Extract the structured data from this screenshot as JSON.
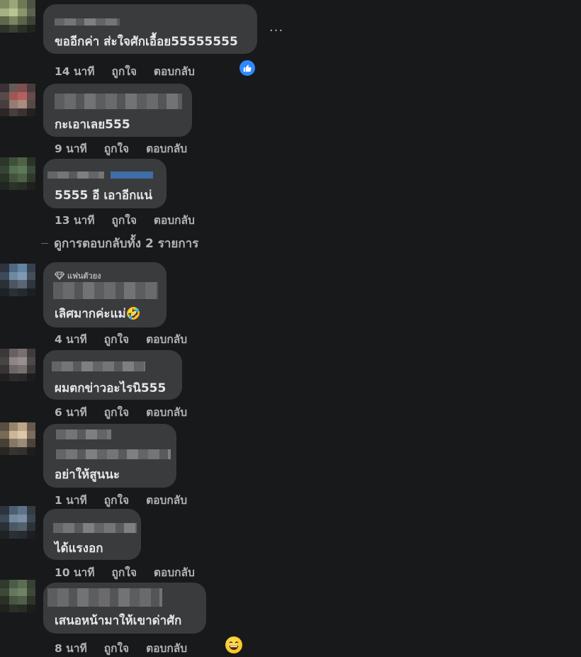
{
  "comments": [
    {
      "text": "ขออีกค่า ส่ะใจศักเอื้อย55555555",
      "time": "14 นาที",
      "like": "ถูกใจ",
      "reply": "ตอบกลับ"
    },
    {
      "text": "กะเอาเลย555",
      "time": "9 นาที",
      "like": "ถูกใจ",
      "reply": "ตอบกลับ"
    },
    {
      "text": "5555 อี เอาอีกแน่",
      "time": "13 นาที",
      "like": "ถูกใจ",
      "reply": "ตอบกลับ"
    },
    {
      "text": "เลิศมากค่ะแม่🤣",
      "time": "4 นาที",
      "like": "ถูกใจ",
      "reply": "ตอบกลับ",
      "badge": "แฟนตัวยง"
    },
    {
      "text": "ผมตกข่าวอะไรนิ555",
      "time": "6 นาที",
      "like": "ถูกใจ",
      "reply": "ตอบกลับ"
    },
    {
      "text": "อย่าให้สูนนะ",
      "time": "1 นาที",
      "like": "ถูกใจ",
      "reply": "ตอบกลับ"
    },
    {
      "text": "ได้แรงอก",
      "time": "10 นาที",
      "like": "ถูกใจ",
      "reply": "ตอบกลับ"
    },
    {
      "text": "เสนอหน้ามาให้เขาด่าศัก",
      "time": "8 นาที",
      "like": "ถูกใจ",
      "reply": "ตอบกลับ"
    }
  ],
  "view_replies": "ดูการตอบกลับทั้ง 2 รายการ",
  "more_label": "...",
  "colors": {
    "background": "#18191a",
    "bubble": "#3a3b3c",
    "text": "#e4e6eb",
    "meta": "#b0b3b8",
    "like_badge": "#2e89ff"
  },
  "icons": [
    "like-icon",
    "more-icon",
    "diamond-icon",
    "laughing-emoji-icon"
  ]
}
